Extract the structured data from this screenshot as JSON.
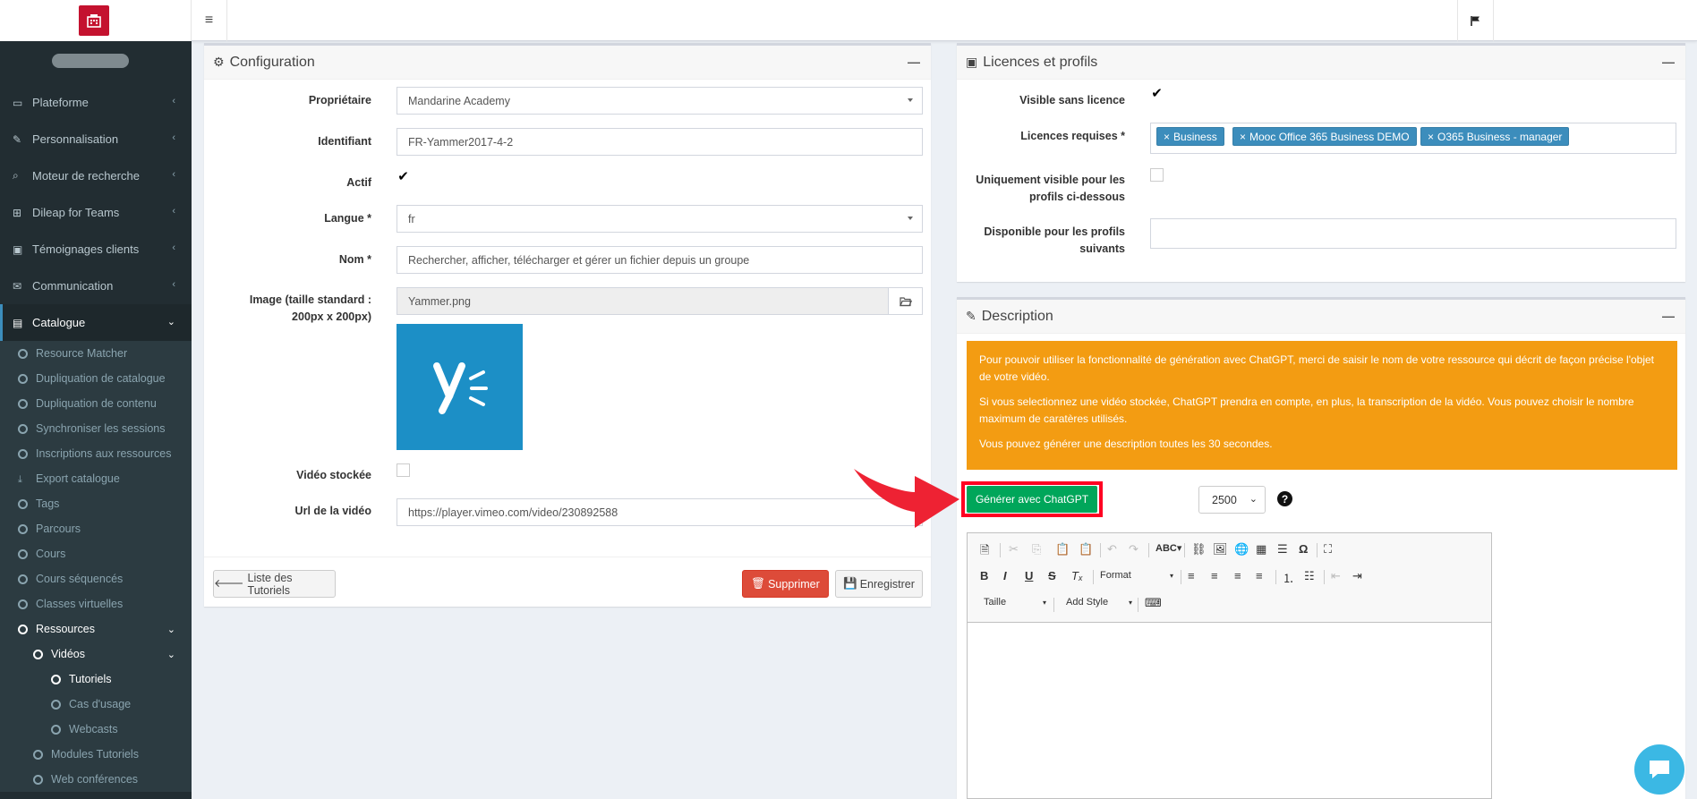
{
  "sidebar": {
    "items": [
      {
        "label": "Plateforme",
        "icon": "laptop-icon"
      },
      {
        "label": "Personnalisation",
        "icon": "brush-icon"
      },
      {
        "label": "Moteur de recherche",
        "icon": "search-icon"
      },
      {
        "label": "Dileap for Teams",
        "icon": "windows-icon"
      },
      {
        "label": "Témoignages clients",
        "icon": "id-card-icon"
      },
      {
        "label": "Communication",
        "icon": "envelope-open-icon"
      },
      {
        "label": "Catalogue",
        "icon": "book-icon"
      }
    ],
    "catalogue_sub": [
      "Resource Matcher",
      "Dupliquation de catalogue",
      "Dupliquation de contenu",
      "Synchroniser les sessions",
      "Inscriptions aux ressources",
      "Export catalogue",
      "Tags",
      "Parcours",
      "Cours",
      "Cours séquencés",
      "Classes virtuelles",
      "Ressources"
    ],
    "videos_label": "Vidéos",
    "videos_sub": [
      "Tutoriels",
      "Cas d'usage",
      "Webcasts"
    ],
    "after": [
      "Modules Tutoriels",
      "Web conférences"
    ]
  },
  "config": {
    "title": "Configuration",
    "owner_label": "Propriétaire",
    "owner_value": "Mandarine Academy",
    "id_label": "Identifiant",
    "id_value": "FR-Yammer2017-4-2",
    "active_label": "Actif",
    "lang_label": "Langue *",
    "lang_value": "fr",
    "name_label": "Nom *",
    "name_value": "Rechercher, afficher, télécharger et gérer un fichier depuis un groupe",
    "image_label": "Image (taille standard : 200px x 200px)",
    "image_value": "Yammer.png",
    "stored_label": "Vidéo stockée",
    "url_label": "Url de la vidéo",
    "url_value": "https://player.vimeo.com/video/230892588",
    "back_button": "Liste des Tutoriels",
    "delete_button": "Supprimer",
    "save_button": "Enregistrer"
  },
  "licences": {
    "title": "Licences et profils",
    "visible_label": "Visible sans licence",
    "required_label": "Licences requises *",
    "tags": [
      "Business",
      "Mooc Office 365 Business DEMO",
      "O365 Business - manager"
    ],
    "only_visible_label": "Uniquement visible pour les profils ci-dessous",
    "available_label": "Disponible pour les profils suivants"
  },
  "description": {
    "title": "Description",
    "warning": [
      "Pour pouvoir utiliser la fonctionnalité de génération avec ChatGPT, merci de saisir le nom de votre ressource qui décrit de façon précise l'objet de votre vidéo.",
      "Si vous selectionnez une vidéo stockée, ChatGPT prendra en compte, en plus, la transcription de la vidéo. Vous pouvez choisir le nombre maximum de caratères utilisés.",
      "Vous pouvez générer une description toutes les 30 secondes."
    ],
    "generate_button": "Générer avec ChatGPT",
    "max_chars": "2500",
    "editor": {
      "format": "Format",
      "size": "Taille",
      "style": "Add Style"
    }
  },
  "colors": {
    "sidebar": "#222d32",
    "warning": "#f39c12",
    "generate": "#00a65a",
    "highlight": "#ff0022"
  }
}
